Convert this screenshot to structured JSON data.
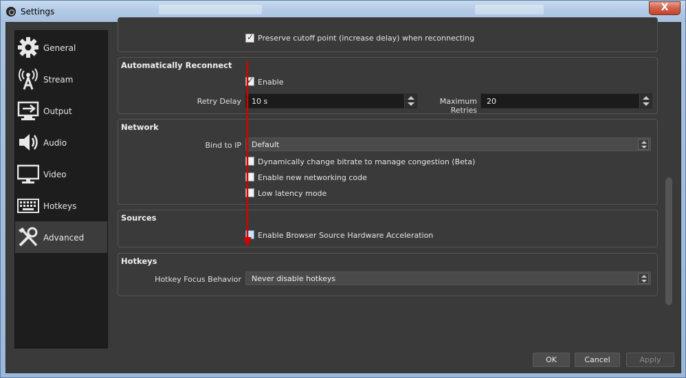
{
  "window": {
    "title": "Settings",
    "close_symbol": "X"
  },
  "sidebar": {
    "items": [
      {
        "label": "General",
        "icon": "gear-icon"
      },
      {
        "label": "Stream",
        "icon": "broadcast-icon"
      },
      {
        "label": "Output",
        "icon": "output-icon"
      },
      {
        "label": "Audio",
        "icon": "speaker-icon"
      },
      {
        "label": "Video",
        "icon": "monitor-icon"
      },
      {
        "label": "Hotkeys",
        "icon": "keyboard-icon"
      },
      {
        "label": "Advanced",
        "icon": "tools-icon",
        "active": true
      }
    ]
  },
  "sections": {
    "top": {
      "preserve_label": "Preserve cutoff point (increase delay) when reconnecting",
      "preserve_checked": true
    },
    "reconnect": {
      "title": "Automatically Reconnect",
      "enable_label": "Enable",
      "enable_checked": true,
      "retry_delay_label": "Retry Delay",
      "retry_delay_value": "10 s",
      "max_retries_label": "Maximum Retries",
      "max_retries_value": "20"
    },
    "network": {
      "title": "Network",
      "bind_label": "Bind to IP",
      "bind_value": "Default",
      "dynamic_bitrate_label": "Dynamically change bitrate to manage congestion (Beta)",
      "new_networking_label": "Enable new networking code",
      "low_latency_label": "Low latency mode"
    },
    "sources": {
      "title": "Sources",
      "browser_accel_label": "Enable Browser Source Hardware Acceleration"
    },
    "hotkeys": {
      "title": "Hotkeys",
      "focus_label": "Hotkey Focus Behavior",
      "focus_value": "Never disable hotkeys"
    }
  },
  "buttons": {
    "ok": "OK",
    "cancel": "Cancel",
    "apply": "Apply"
  },
  "colors": {
    "annotation_arrow": "#d40000",
    "panel_bg": "#3a3a3a",
    "sidebar_bg": "#1d1d1d"
  }
}
